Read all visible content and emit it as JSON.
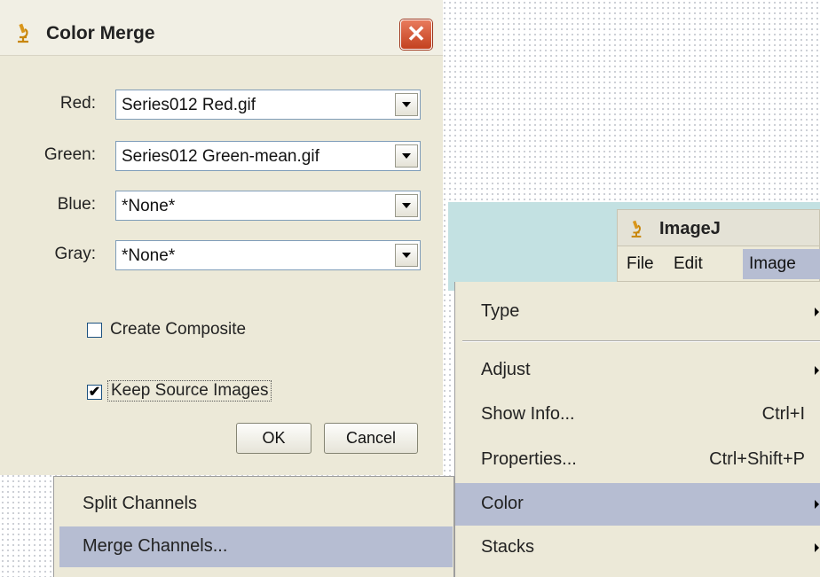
{
  "color_merge": {
    "title": "Color Merge",
    "close_glyph": "✕",
    "fields": [
      {
        "label": "Red:",
        "value": "Series012 Red.gif"
      },
      {
        "label": "Green:",
        "value": "Series012 Green-mean.gif"
      },
      {
        "label": "Blue:",
        "value": "*None*"
      },
      {
        "label": "Gray:",
        "value": "*None*"
      }
    ],
    "create_composite": {
      "label": "Create Composite",
      "checked": false
    },
    "keep_source": {
      "label": "Keep Source Images",
      "checked": true,
      "mark": "✔"
    },
    "ok_label": "OK",
    "cancel_label": "Cancel"
  },
  "imagej": {
    "title": "ImageJ",
    "menubar": [
      "File",
      "Edit",
      "Image"
    ],
    "image_menu": [
      {
        "label": "Type",
        "submenu": true
      },
      {
        "label": "Adjust",
        "submenu": true
      },
      {
        "label": "Show Info...",
        "shortcut": "Ctrl+I"
      },
      {
        "label": "Properties...",
        "shortcut": "Ctrl+Shift+P"
      },
      {
        "label": "Color",
        "submenu": true,
        "active": true
      },
      {
        "label": "Stacks",
        "submenu": true
      }
    ],
    "color_submenu": [
      {
        "label": "Split Channels"
      },
      {
        "label": "Merge Channels...",
        "active": true
      }
    ]
  },
  "colors": {
    "menu_highlight": "#b6bdd2",
    "dialog_bg": "#ece9d8",
    "teal_bg": "#c3e1e2",
    "close_button": "#c3411f"
  },
  "icons": {
    "app_icon": "microscope-icon",
    "submenu_arrow": "chevron-right-icon",
    "combo_arrow": "chevron-down-icon"
  }
}
